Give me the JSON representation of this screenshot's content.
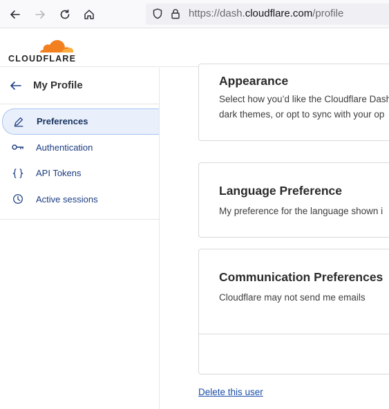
{
  "browser": {
    "url_prefix": "https://dash.",
    "url_host": "cloudflare.com",
    "url_path": "/profile"
  },
  "brand": {
    "wordmark": "CLOUDFLARE",
    "accent": "#f38020"
  },
  "sidebar": {
    "title": "My Profile",
    "items": [
      {
        "label": "Preferences",
        "icon": "pencil-icon",
        "active": true
      },
      {
        "label": "Authentication",
        "icon": "key-icon",
        "active": false
      },
      {
        "label": "API Tokens",
        "icon": "braces-icon",
        "active": false
      },
      {
        "label": "Active sessions",
        "icon": "clock-icon",
        "active": false
      }
    ]
  },
  "main": {
    "appearance": {
      "title": "Appearance",
      "desc_line1": "Select how you’d like the Cloudflare Dash",
      "desc_line2": "dark themes, or opt to sync with your op"
    },
    "language": {
      "title": "Language Preference",
      "desc": "My preference for the language shown i"
    },
    "communication": {
      "title": "Communication Preferences",
      "desc": "Cloudflare may not send me emails"
    },
    "delete_link": "Delete this user"
  }
}
